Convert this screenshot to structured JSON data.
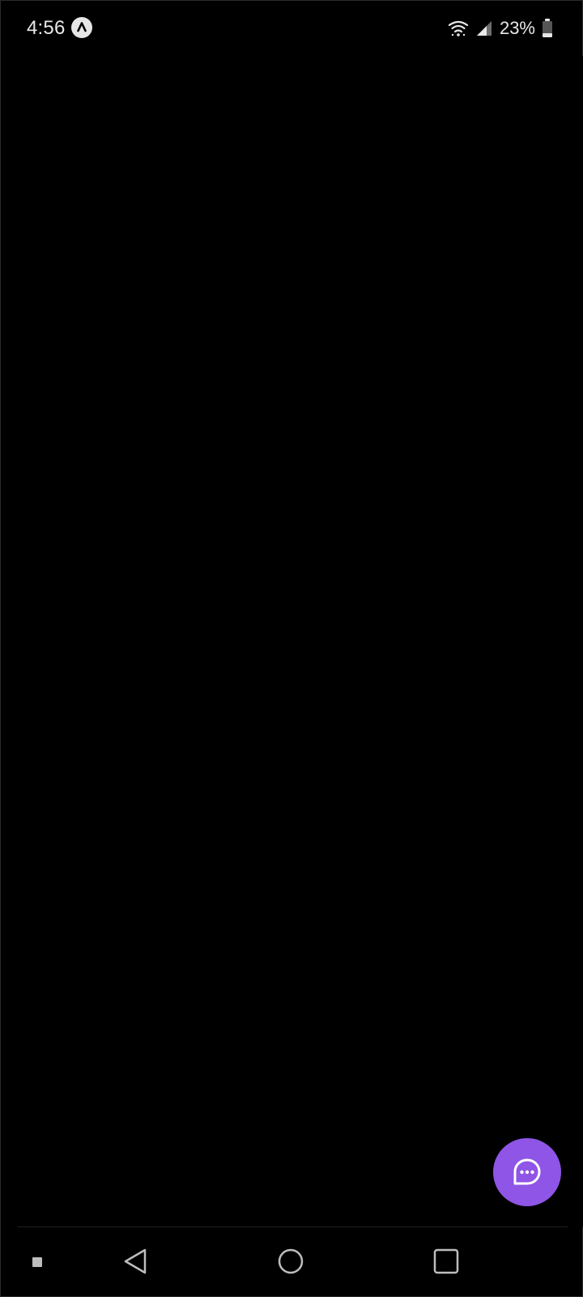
{
  "status_bar": {
    "time": "4:56",
    "app_icon": "upward-caret-badge-icon",
    "wifi_icon": "wifi-icon",
    "signal_icon": "cell-signal-icon",
    "battery_text": "23%",
    "battery_icon": "battery-icon",
    "battery_level": 0.23
  },
  "floating_button": {
    "icon": "chat-bubble-icon",
    "color": "#8e55e6"
  },
  "navigation_bar": {
    "back_icon": "back-triangle-icon",
    "home_icon": "home-circle-icon",
    "recents_icon": "recents-square-icon"
  },
  "colors": {
    "background": "#000000",
    "status_text": "#e8e8e8",
    "accent": "#8e55e6"
  }
}
